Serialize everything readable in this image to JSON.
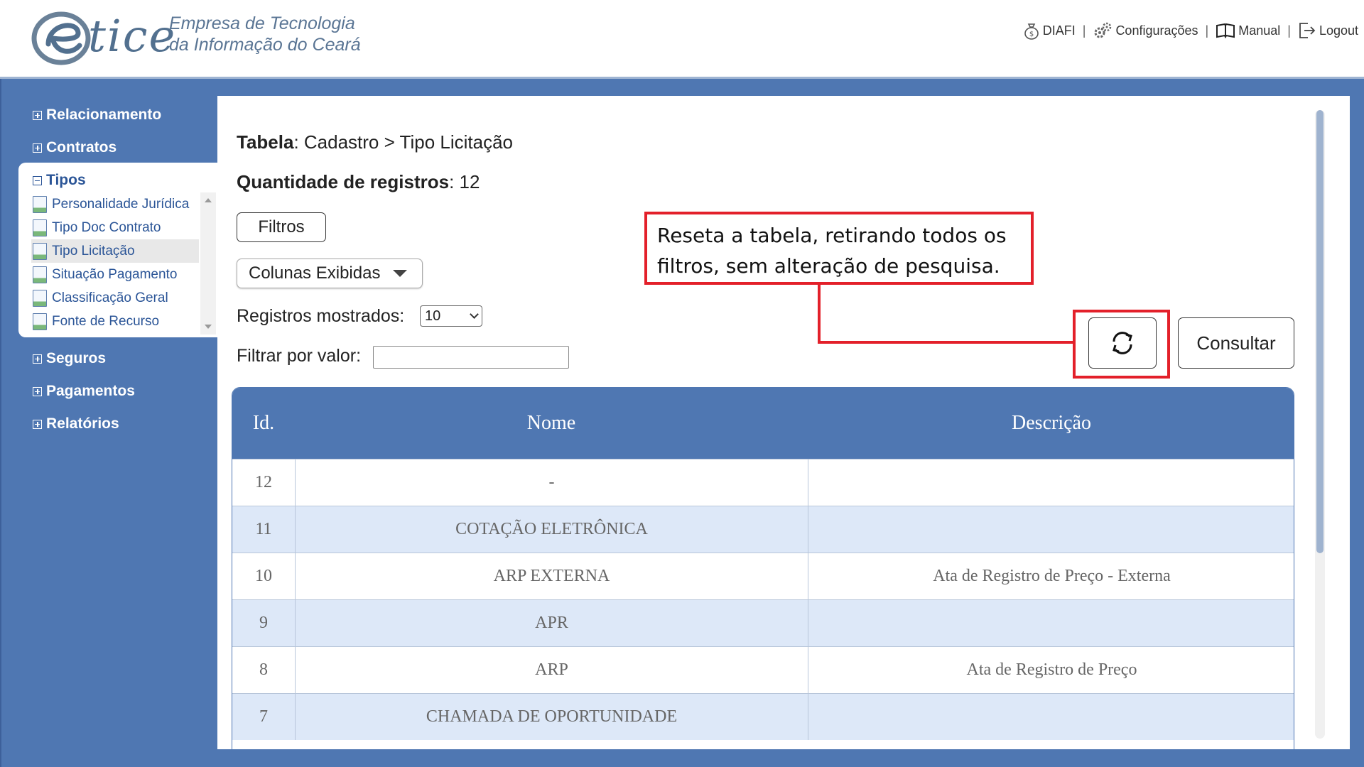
{
  "header": {
    "logo_tice": "tice",
    "company_line1": "Empresa de Tecnologia",
    "company_line2": "da Informação do Ceará",
    "nav": [
      {
        "label": "DIAFI",
        "icon": "money-bag-icon"
      },
      {
        "label": "Configurações",
        "icon": "gears-icon"
      },
      {
        "label": "Manual",
        "icon": "book-icon"
      },
      {
        "label": "Logout",
        "icon": "logout-icon"
      }
    ],
    "separator": "|"
  },
  "sidebar": {
    "items": [
      {
        "label": "Relacionamento"
      },
      {
        "label": "Contratos"
      },
      {
        "label": "Tipos"
      },
      {
        "label": "Seguros"
      },
      {
        "label": "Pagamentos"
      },
      {
        "label": "Relatórios"
      }
    ],
    "tipos_subitems": [
      {
        "label": "Personalidade Jurídica"
      },
      {
        "label": "Tipo Doc Contrato"
      },
      {
        "label": "Tipo Licitação"
      },
      {
        "label": "Situação Pagamento"
      },
      {
        "label": "Classificação Geral"
      },
      {
        "label": "Fonte de Recurso"
      }
    ],
    "active_subitem": "Tipo Licitação"
  },
  "main": {
    "tabela_label": "Tabela",
    "tabela_value": ": Cadastro > Tipo Licitação",
    "quantidade_label": "Quantidade de registros",
    "quantidade_value": ": 12",
    "filtros_button": "Filtros",
    "colunas_button": "Colunas Exibidas",
    "registros_label": "Registros mostrados:",
    "registros_value": "10",
    "filtrar_label": "Filtrar por valor:",
    "filtrar_value": "",
    "consultar_button": "Consultar"
  },
  "table": {
    "headers": [
      "Id.",
      "Nome",
      "Descrição"
    ],
    "rows": [
      {
        "id": "12",
        "nome": "-",
        "descricao": ""
      },
      {
        "id": "11",
        "nome": "COTAÇÃO ELETRÔNICA",
        "descricao": ""
      },
      {
        "id": "10",
        "nome": "ARP EXTERNA",
        "descricao": "Ata de Registro de Preço - Externa"
      },
      {
        "id": "9",
        "nome": "APR",
        "descricao": ""
      },
      {
        "id": "8",
        "nome": "ARP",
        "descricao": "Ata de Registro de Preço"
      },
      {
        "id": "7",
        "nome": "CHAMADA DE OPORTUNIDADE",
        "descricao": ""
      }
    ]
  },
  "annotation": {
    "line1": "Reseta a tabela, retirando todos os",
    "line2": "filtros, sem alteração de pesquisa.",
    "color": "#e3202a"
  },
  "colors": {
    "frame_blue": "#4f77b2",
    "row_alt": "#dde8f8"
  }
}
